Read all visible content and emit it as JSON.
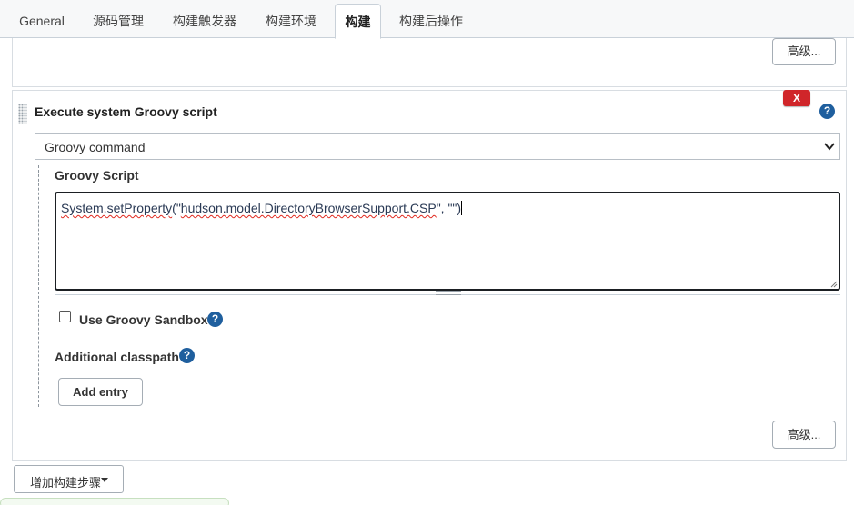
{
  "tabs": [
    {
      "label": "General",
      "active": false
    },
    {
      "label": "源码管理",
      "active": false
    },
    {
      "label": "构建触发器",
      "active": false
    },
    {
      "label": "构建环境",
      "active": false
    },
    {
      "label": "构建",
      "active": true
    },
    {
      "label": "构建后操作",
      "active": false
    }
  ],
  "prev_section": {
    "advanced_label": "高级..."
  },
  "build_step": {
    "title": "Execute system Groovy script",
    "delete_label": "X",
    "help_glyph": "?",
    "source_select": {
      "selected": "Groovy command"
    },
    "script_label": "Groovy Script",
    "script_value": {
      "part1": "System.setProperty",
      "part2": "(\"",
      "part3": "hudson.model.DirectoryBrowserSupport.CSP",
      "part4": "\", \"\")"
    },
    "sandbox": {
      "label": "Use Groovy Sandbox",
      "checked": false
    },
    "classpath_label": "Additional classpath",
    "add_entry_label": "Add entry",
    "advanced_label": "高级..."
  },
  "add_build_step_label": "增加构建步骤",
  "colors": {
    "accent_blue": "#1f5f9e",
    "delete_red": "#d0262a",
    "tabbar_bg": "#f7f8f9"
  },
  "icons": [
    "help-icon",
    "delete-icon",
    "chevron-down-icon",
    "drag-handle-icon",
    "caret-down-icon",
    "resize-grip-icon"
  ]
}
